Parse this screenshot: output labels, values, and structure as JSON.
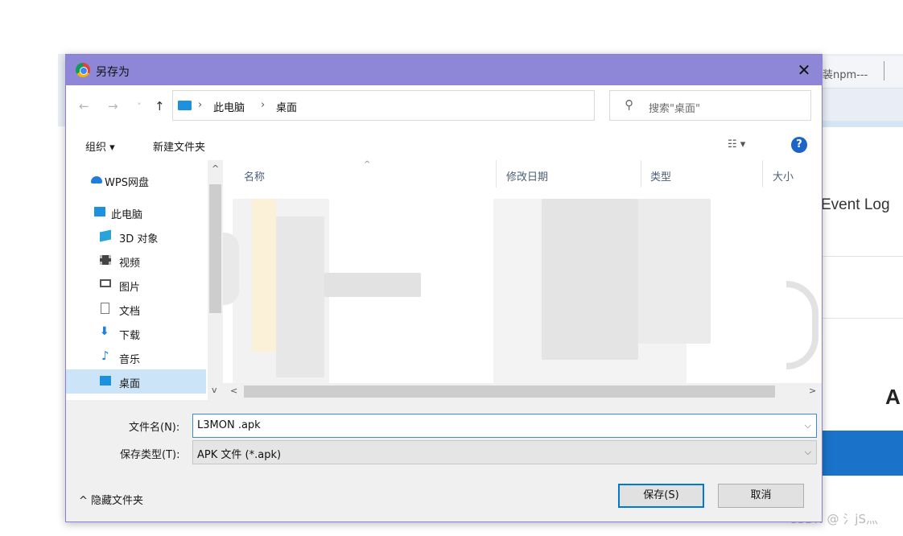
{
  "background": {
    "tab_text": "装npm---",
    "heading": "Event Log",
    "glyph": "A",
    "watermark": "CSDN @ 氵jS灬"
  },
  "dialog": {
    "title": "另存为",
    "close_glyph": "✕",
    "nav": {
      "back": "←",
      "forward": "→",
      "recent": "˅",
      "up": "↑"
    },
    "breadcrumb": [
      "此电脑",
      "桌面"
    ],
    "breadcrumb_sep": "›",
    "address_dropdown": "⌵",
    "refresh": "↻",
    "search_placeholder": "搜索\"桌面\"",
    "toolbar": {
      "organize": "组织 ▾",
      "new_folder": "新建文件夹",
      "view": "☷ ▾",
      "help": "?"
    },
    "sidebar": [
      {
        "label": "WPS网盘",
        "icon": "cloud-icon",
        "color": "#1e7fd8"
      },
      {
        "label": "此电脑",
        "icon": "computer-icon",
        "color": "#1e90e0"
      },
      {
        "label": "3D 对象",
        "icon": "cube-3d-icon",
        "color": "#29a3d9"
      },
      {
        "label": "视频",
        "icon": "film-icon",
        "color": "#444444"
      },
      {
        "label": "图片",
        "icon": "picture-icon",
        "color": "#555555"
      },
      {
        "label": "文档",
        "icon": "document-icon",
        "color": "#777777"
      },
      {
        "label": "下载",
        "icon": "download-arrow-icon",
        "color": "#1e7fd8"
      },
      {
        "label": "音乐",
        "icon": "music-note-icon",
        "color": "#1e7fd8"
      },
      {
        "label": "桌面",
        "icon": "desktop-icon",
        "color": "#1e90e0",
        "selected": true
      }
    ],
    "columns": [
      "名称",
      "修改日期",
      "类型",
      "大小"
    ],
    "form": {
      "filename_label": "文件名(N):",
      "filename_value": "L3MON .apk",
      "filetype_label": "保存类型(T):",
      "filetype_value": "APK 文件 (*.apk)",
      "dropdown_arrow": "⌵"
    },
    "hide_folders": "^ 隐藏文件夹",
    "save_button": "保存(S)",
    "cancel_button": "取消"
  },
  "colors": {
    "title_bar": "#8e87d8",
    "accent": "#0078d7",
    "selected_row": "#cce4f7",
    "page_button": "#1a73c8"
  }
}
